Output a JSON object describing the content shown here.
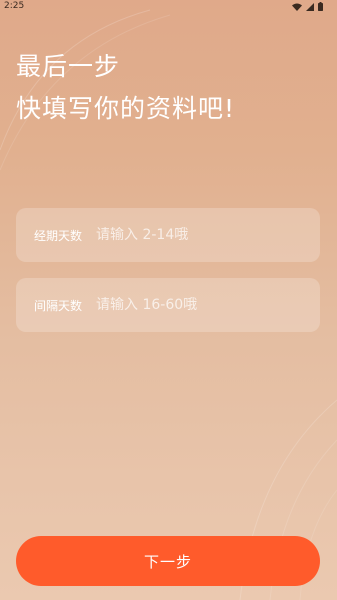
{
  "status_bar": {
    "time": "2:25",
    "icons": [
      "wifi-icon",
      "signal-icon",
      "battery-icon"
    ]
  },
  "headline": {
    "line1": "最后一步",
    "line2": "快填写你的资料吧!"
  },
  "form": {
    "period_days": {
      "label": "经期天数",
      "placeholder": "请输入 2-14哦",
      "value": ""
    },
    "cycle_days": {
      "label": "间隔天数",
      "placeholder": "请输入 16-60哦",
      "value": ""
    }
  },
  "next_button": {
    "label": "下一步"
  },
  "colors": {
    "accent": "#ff5b2b",
    "background_top": "#e0a98a",
    "background_bottom": "#ebc9b0"
  }
}
